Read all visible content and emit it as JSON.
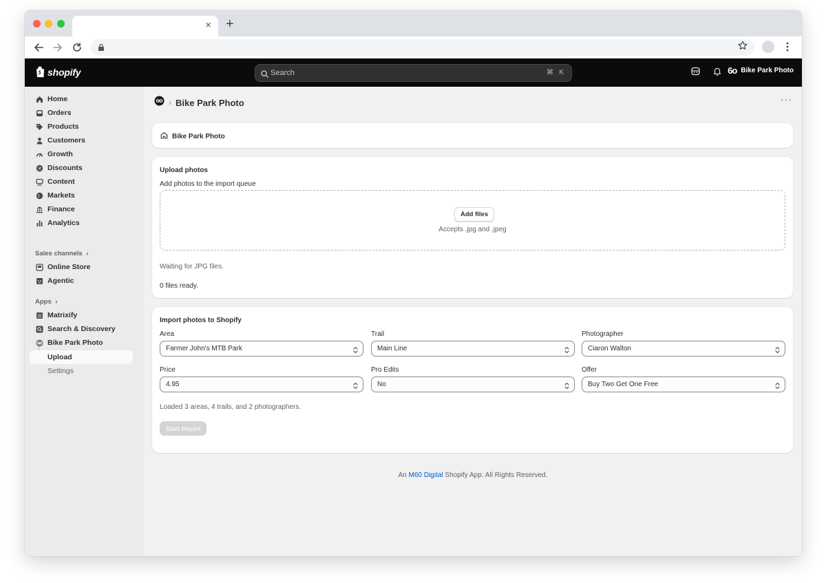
{
  "browser": {
    "tab_title": "",
    "close_glyph": "×",
    "new_tab_glyph": "+",
    "url": ""
  },
  "topbar": {
    "logo_text": "shopify",
    "search_placeholder": "Search",
    "kbd_cmd": "⌘",
    "kbd_key": "K",
    "store_name": "Bike Park Photo",
    "store_avatar_glyph": "6o"
  },
  "sidebar": {
    "items": [
      {
        "label": "Home",
        "icon": "home-icon"
      },
      {
        "label": "Orders",
        "icon": "inbox-icon"
      },
      {
        "label": "Products",
        "icon": "tag-icon"
      },
      {
        "label": "Customers",
        "icon": "person-icon"
      },
      {
        "label": "Growth",
        "icon": "gauge-icon"
      },
      {
        "label": "Discounts",
        "icon": "discount-icon"
      },
      {
        "label": "Content",
        "icon": "content-icon"
      },
      {
        "label": "Markets",
        "icon": "globe-icon"
      },
      {
        "label": "Finance",
        "icon": "bank-icon"
      },
      {
        "label": "Analytics",
        "icon": "bar-chart-icon"
      }
    ],
    "sales_channels_label": "Sales channels",
    "sales_channels": [
      {
        "label": "Online Store",
        "icon": "store-icon"
      },
      {
        "label": "Agentic",
        "icon": "agentic-icon"
      }
    ],
    "apps_label": "Apps",
    "apps": [
      {
        "label": "Matrixify",
        "icon": "matrixify-icon"
      },
      {
        "label": "Search & Discovery",
        "icon": "search-discovery-icon"
      },
      {
        "label": "Bike Park Photo",
        "icon": "bike-park-photo-icon"
      }
    ],
    "app_sub": [
      {
        "label": "Upload"
      },
      {
        "label": "Settings"
      }
    ],
    "chevron_glyph": "›"
  },
  "main": {
    "breadcrumb_sep": "›",
    "page_title": "Bike Park Photo",
    "more_glyph": "···",
    "home_card_label": "Bike Park Photo",
    "upload": {
      "heading": "Upload photos",
      "subheading": "Add photos to the import queue",
      "add_files_label": "Add files",
      "accepts_text": "Accepts .jpg and .jpeg",
      "status_text": "Waiting for JPG files.",
      "ready_text": "0 files ready."
    },
    "import": {
      "heading": "Import photos to Shopify",
      "fields": [
        {
          "label": "Area",
          "value": "Farmer John's MTB Park"
        },
        {
          "label": "Trail",
          "value": "Main Line"
        },
        {
          "label": "Photographer",
          "value": "Ciaron Walton"
        },
        {
          "label": "Price",
          "value": "4.95"
        },
        {
          "label": "Pro Edits",
          "value": "No"
        },
        {
          "label": "Offer",
          "value": "Buy Two Get One Free"
        }
      ],
      "loaded_text": "Loaded 3 areas, 4 trails, and 2 photographers.",
      "start_label": "Start Import"
    },
    "footer": {
      "prefix": "An",
      "link": "M60 Digital",
      "suffix": "Shopify App. All Rights Reserved."
    }
  }
}
